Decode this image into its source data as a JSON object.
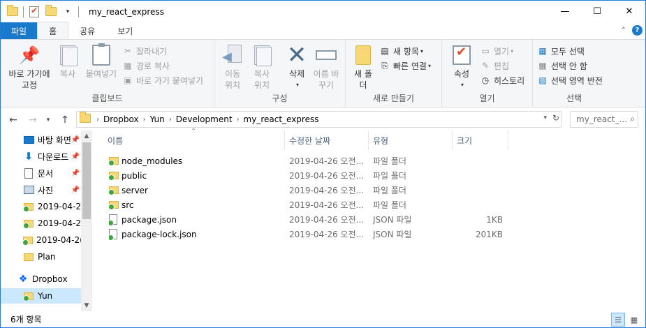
{
  "window": {
    "title": "my_react_express",
    "controls": {
      "minimize": "—",
      "maximize": "☐",
      "close": "✕"
    }
  },
  "tabs": [
    {
      "label": "파일"
    },
    {
      "label": "홈"
    },
    {
      "label": "공유"
    },
    {
      "label": "보기"
    }
  ],
  "ribbon": {
    "clipboard": {
      "label": "클립보드",
      "pin_quick": "바로 가기에 고정",
      "copy": "복사",
      "paste": "붙여넣기",
      "cut": "잘라내기",
      "copy_path": "경로 복사",
      "paste_shortcut": "바로 가기 붙여넣기"
    },
    "organize": {
      "label": "구성",
      "move_to": "이동 위치",
      "copy_to": "복사 위치",
      "delete": "삭제",
      "rename": "이름 바꾸기"
    },
    "new": {
      "label": "새로 만들기",
      "new_folder": "새 폴더",
      "new_item": "새 항목",
      "easy_access": "빠른 연결"
    },
    "open": {
      "label": "열기",
      "properties": "속성",
      "open": "열기",
      "edit": "편집",
      "history": "히스토리"
    },
    "select": {
      "label": "선택",
      "select_all": "모두 선택",
      "select_none": "선택 안 함",
      "invert": "선택 영역 반전"
    }
  },
  "address": {
    "crumbs": [
      "Dropbox",
      "Yun",
      "Development",
      "my_react_express"
    ],
    "search_placeholder": "my_react_..."
  },
  "nav": {
    "items": [
      {
        "label": "바탕 화면",
        "icon": "desktop-icon",
        "pinned": true
      },
      {
        "label": "다운로드",
        "icon": "download-icon",
        "pinned": true
      },
      {
        "label": "문서",
        "icon": "documents-icon",
        "pinned": true
      },
      {
        "label": "사진",
        "icon": "pictures-icon",
        "pinned": true
      },
      {
        "label": "2019-04-2",
        "icon": "folder-icon",
        "pinned": false
      },
      {
        "label": "2019-04-2",
        "icon": "folder-icon",
        "pinned": false
      },
      {
        "label": "2019-04-2(",
        "icon": "folder-icon",
        "pinned": false
      },
      {
        "label": "Plan",
        "icon": "folder-icon",
        "pinned": false
      },
      {
        "label": "Dropbox",
        "icon": "dropbox-icon",
        "pinned": false
      },
      {
        "label": "Yun",
        "icon": "folder-icon",
        "pinned": false,
        "selected": true
      }
    ]
  },
  "columns": {
    "name": "이름",
    "modified": "수정한 날짜",
    "type": "유형",
    "size": "크기"
  },
  "files": [
    {
      "name": "node_modules",
      "modified": "2019-04-26 오전...",
      "type": "파일 폴더",
      "size": "",
      "kind": "folder"
    },
    {
      "name": "public",
      "modified": "2019-04-26 오전...",
      "type": "파일 폴더",
      "size": "",
      "kind": "folder"
    },
    {
      "name": "server",
      "modified": "2019-04-26 오전...",
      "type": "파일 폴더",
      "size": "",
      "kind": "folder"
    },
    {
      "name": "src",
      "modified": "2019-04-26 오전...",
      "type": "파일 폴더",
      "size": "",
      "kind": "folder"
    },
    {
      "name": "package.json",
      "modified": "2019-04-26 오전...",
      "type": "JSON 파일",
      "size": "1KB",
      "kind": "file"
    },
    {
      "name": "package-lock.json",
      "modified": "2019-04-26 오전...",
      "type": "JSON 파일",
      "size": "201KB",
      "kind": "file"
    }
  ],
  "status": {
    "item_count": "6개 항목"
  },
  "colors": {
    "accent": "#1979ca",
    "selection": "#cce8ff",
    "folder": "#f8d775"
  }
}
